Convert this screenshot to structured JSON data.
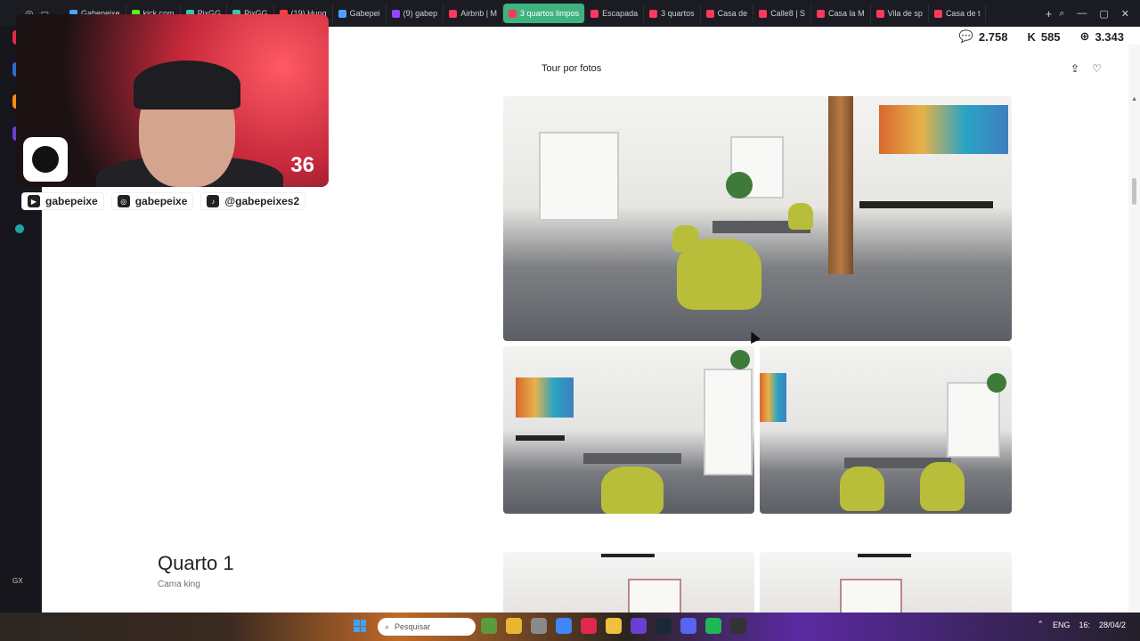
{
  "browser": {
    "tabs": [
      {
        "label": "Gabepeixe",
        "color": "#4aa3ff"
      },
      {
        "label": "kick.com",
        "color": "#53fc18"
      },
      {
        "label": "PixGG",
        "color": "#37c8a5"
      },
      {
        "label": "PixGG",
        "color": "#37c8a5"
      },
      {
        "label": "(19) Hung",
        "color": "#ff3b3b"
      },
      {
        "label": "Gabepei",
        "color": "#4aa3ff"
      },
      {
        "label": "(9) gabep",
        "color": "#9146ff"
      },
      {
        "label": "Airbnb | M",
        "color": "#ff385c"
      },
      {
        "label": "3 quartos limpos",
        "color": "#ff385c",
        "active": true
      },
      {
        "label": "Escapada",
        "color": "#ff385c"
      },
      {
        "label": "3 quartos",
        "color": "#ff385c"
      },
      {
        "label": "Casa de",
        "color": "#ff385c"
      },
      {
        "label": "Calle8 | S",
        "color": "#ff385c"
      },
      {
        "label": "Casa la M",
        "color": "#ff385c"
      },
      {
        "label": "Vila de sp",
        "color": "#ff385c"
      },
      {
        "label": "Casa de t",
        "color": "#ff385c"
      }
    ],
    "add_tab": "+"
  },
  "counters": [
    {
      "icon": "twitch-icon",
      "value": "2.758"
    },
    {
      "icon": "kick-icon",
      "value": "585"
    },
    {
      "icon": "globe-icon",
      "value": "3.343"
    }
  ],
  "webcam": {
    "number": "36"
  },
  "socials": [
    {
      "icon": "youtube-icon",
      "label": "gabepeixe"
    },
    {
      "icon": "instagram-icon",
      "label": "gabepeixe"
    },
    {
      "icon": "tiktok-icon",
      "label": "@gabepeixes2"
    }
  ],
  "page": {
    "title": "Tour por fotos",
    "room_title": "Quarto 1",
    "room_subtitle": "Cama king"
  },
  "taskbar": {
    "search_placeholder": "Pesquisar",
    "lang": "ENG",
    "time": "16:",
    "date": "28/04/2"
  },
  "sidebar_gx_label": "GX",
  "colors": {
    "accent_tab": "#3fb27f",
    "airbnb": "#ff385c"
  }
}
